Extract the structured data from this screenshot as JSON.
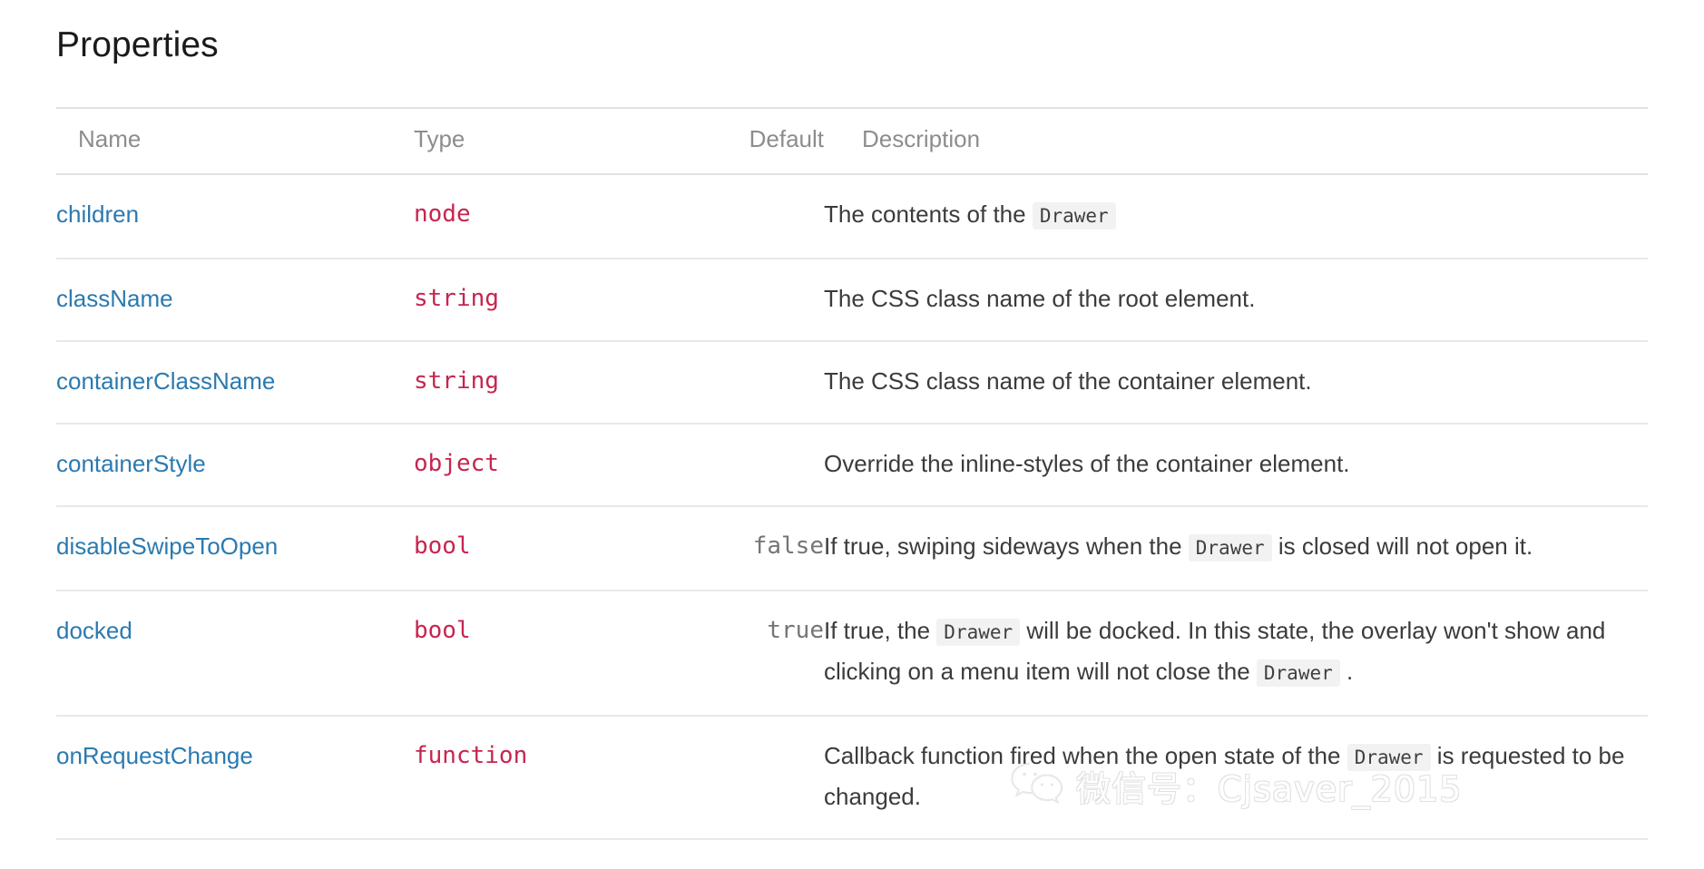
{
  "page": {
    "title": "Properties"
  },
  "table": {
    "headers": {
      "name": "Name",
      "type": "Type",
      "default": "Default",
      "description": "Description"
    },
    "rows": [
      {
        "name": "children",
        "type": "node",
        "default": "",
        "desc_parts": [
          {
            "kind": "text",
            "value": "The contents of the "
          },
          {
            "kind": "code",
            "value": "Drawer"
          }
        ],
        "description": "The contents of the Drawer"
      },
      {
        "name": "className",
        "type": "string",
        "default": "",
        "desc_parts": [
          {
            "kind": "text",
            "value": "The CSS class name of the root element."
          }
        ],
        "description": "The CSS class name of the root element."
      },
      {
        "name": "containerClassName",
        "type": "string",
        "default": "",
        "desc_parts": [
          {
            "kind": "text",
            "value": "The CSS class name of the container element."
          }
        ],
        "description": "The CSS class name of the container element."
      },
      {
        "name": "containerStyle",
        "type": "object",
        "default": "",
        "desc_parts": [
          {
            "kind": "text",
            "value": "Override the inline-styles of the container element."
          }
        ],
        "description": "Override the inline-styles of the container element."
      },
      {
        "name": "disableSwipeToOpen",
        "type": "bool",
        "default": "false",
        "desc_parts": [
          {
            "kind": "text",
            "value": "If true, swiping sideways when the "
          },
          {
            "kind": "code",
            "value": "Drawer"
          },
          {
            "kind": "text",
            "value": " is closed will not open it."
          }
        ],
        "description": "If true, swiping sideways when the Drawer is closed will not open it."
      },
      {
        "name": "docked",
        "type": "bool",
        "default": "true",
        "desc_parts": [
          {
            "kind": "text",
            "value": "If true, the "
          },
          {
            "kind": "code",
            "value": "Drawer"
          },
          {
            "kind": "text",
            "value": " will be docked. In this state, the overlay won't show and clicking on a menu item will not close the "
          },
          {
            "kind": "code",
            "value": "Drawer"
          },
          {
            "kind": "text",
            "value": " ."
          }
        ],
        "description": "If true, the Drawer will be docked. In this state, the overlay won't show and clicking on a menu item will not close the Drawer ."
      },
      {
        "name": "onRequestChange",
        "type": "function",
        "default": "",
        "desc_parts": [
          {
            "kind": "text",
            "value": "Callback function fired when the open state of the "
          },
          {
            "kind": "code",
            "value": "Drawer"
          },
          {
            "kind": "text",
            "value": " is requested to be changed."
          }
        ],
        "description": "Callback function fired when the open state of the Drawer is requested to be changed."
      }
    ]
  },
  "watermark": {
    "text": "微信号：Cjsaver_2015",
    "logo": "wechat-logo-icon"
  },
  "colors": {
    "link": "#2a7ab0",
    "type": "#c7254e",
    "default_value": "#757575",
    "header": "#8d8d8d",
    "body_text": "#3b3b3b",
    "rule": "#e4e4e4",
    "chip_bg": "#f2f2f2"
  }
}
